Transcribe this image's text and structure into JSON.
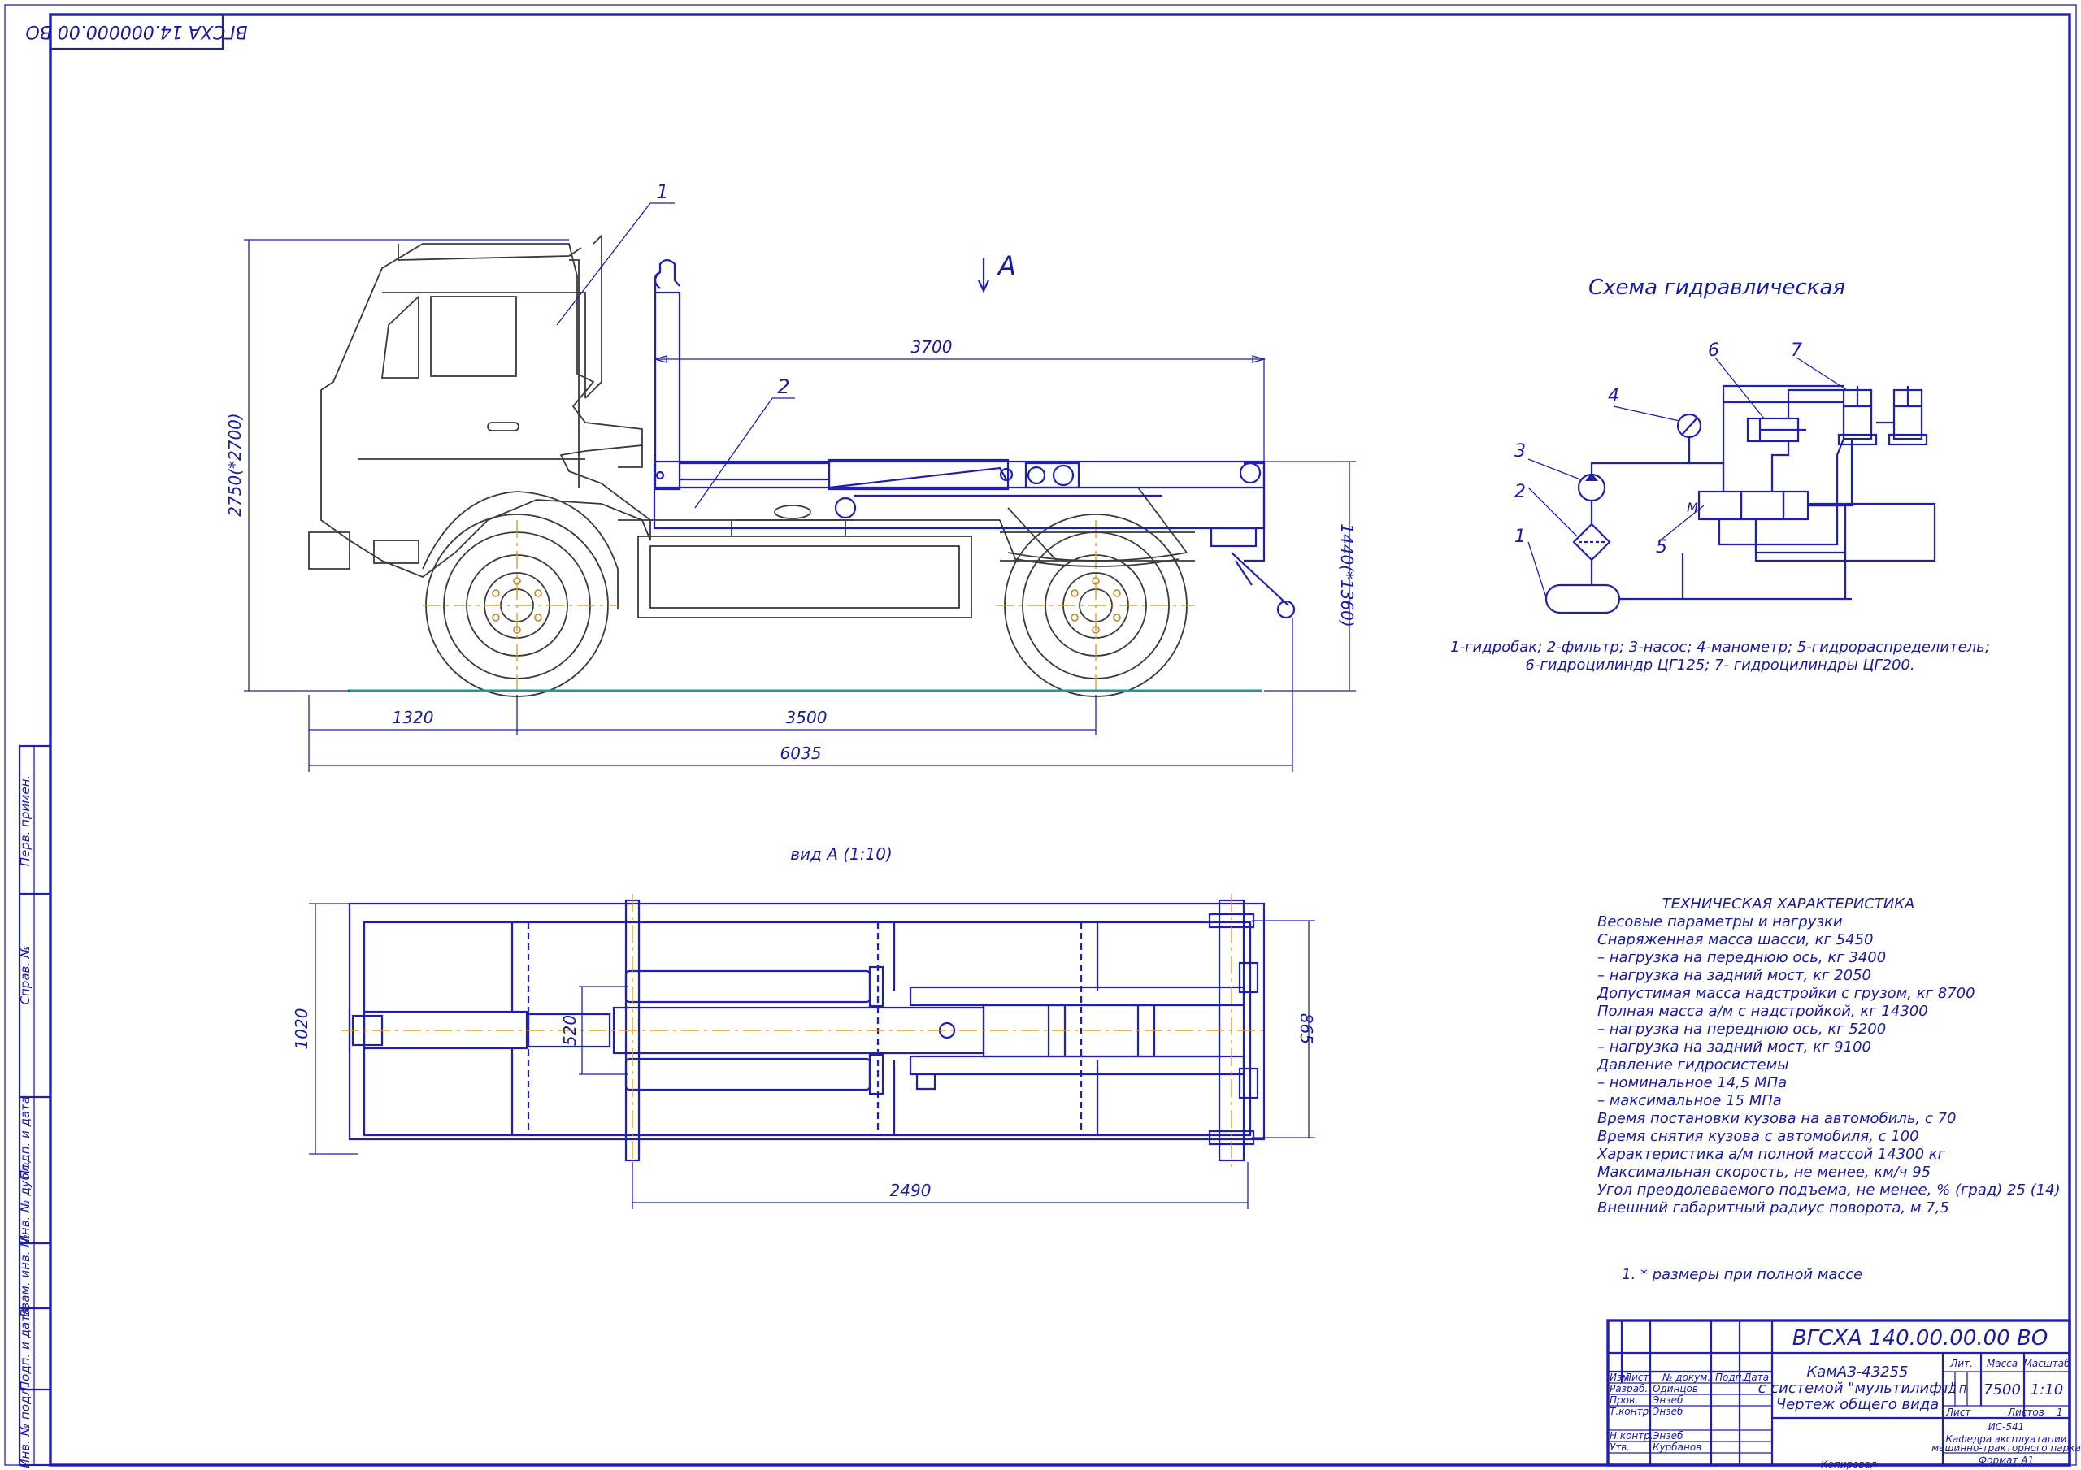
{
  "stamp_code": "ВГСХА 14.000000.00 ВО",
  "view_label": "А",
  "view_a_caption": "вид А (1:10)",
  "dimensions": {
    "d3700": "3700",
    "d1320": "1320",
    "d3500": "3500",
    "d6035": "6035",
    "height_total": "2750(*2700)",
    "height_rear": "1440(*1360)",
    "d1020": "1020",
    "d520": "520",
    "d865": "865",
    "d2490": "2490"
  },
  "callouts": {
    "c1": "1",
    "c2": "2"
  },
  "hydraulic": {
    "title": "Схема гидравлическая",
    "labels": [
      "1",
      "2",
      "3",
      "4",
      "5",
      "6",
      "7"
    ],
    "valve_letter": "M",
    "legend_line1": "1-гидробак; 2-фильтр; 3-насос; 4-манометр; 5-гидрораспределитель;",
    "legend_line2": "6-гидроцилиндр ЦГ125; 7- гидроцилиндры ЦГ200."
  },
  "tech": {
    "title": "ТЕХНИЧЕСКАЯ ХАРАКТЕРИСТИКА",
    "lines": [
      "Весовые параметры и нагрузки",
      "Снаряженная масса шасси, кг   5450",
      " – нагрузка на переднюю ось, кг      3400",
      "– нагрузка на задний мост, кг  2050",
      " Допустимая масса надстройки с грузом, кг     8700",
      "Полная масса а/м с надстройкой, кг     14300",
      " – нагрузка на переднюю ось, кг      5200",
      " – нагрузка на задний мост, кг  9100",
      "Давление гидросистемы",
      "– номинальное  14,5 МПа",
      "– максимальное 15 МПа",
      "Время постановки кузова на автомобиль, с      70",
      "Время снятия кузова с автомобиля, с           100",
      "Характеристика а/м полной массой 14300 кг",
      "Максимальная скорость, не менее, км/ч     95",
      " Угол преодолеваемого подъема, не менее, % (град)     25 (14)",
      "Внешний габаритный радиус поворота, м     7,5"
    ]
  },
  "note": "1.  * размеры при полной массе",
  "title_block": {
    "doc_code": "ВГСХА 140.00.00.00 ВО",
    "name_line1": "КамАЗ-43255",
    "name_line2": "с системой \"мультилифт\"",
    "name_line3": "Чертеж общего вида",
    "hdr_izm": "Изм",
    "hdr_list": "Лист",
    "hdr_doc": "№ докум.",
    "hdr_podp": "Подп.",
    "hdr_data": "Дата",
    "razrab": "Разраб.",
    "razrab_name": "Одинцов",
    "prov": "Пров.",
    "prov_name": "Энзеб",
    "tkontr": "Т.контр.",
    "tkontr_name": "Энзеб",
    "nkontr": "Н.контр.",
    "nkontr_name": "Энзеб",
    "utv": "Утв.",
    "utv_name": "Курбанов",
    "lit": "Лит.",
    "massa": "Масса",
    "masshtab": "Масштаб",
    "lit_val1": "Д",
    "lit_val2": "П",
    "mass_val": "7500",
    "scale_val": "1:10",
    "list_label": "Лист",
    "listov_label": "Листов",
    "listov_val": "1",
    "group": "ИС-541",
    "dept1": "Кафедра эксплуатации",
    "dept2": "машинно-тракторного парка",
    "kopiroval": "Копировал",
    "format": "Формат    А1"
  },
  "side_stamps": [
    "Перв. примен.",
    "Справ. №",
    "Подп. и дата",
    "Инв. № дубл.",
    "Взам. инв. №",
    "Подп. и дата",
    "Инв. № подл."
  ]
}
